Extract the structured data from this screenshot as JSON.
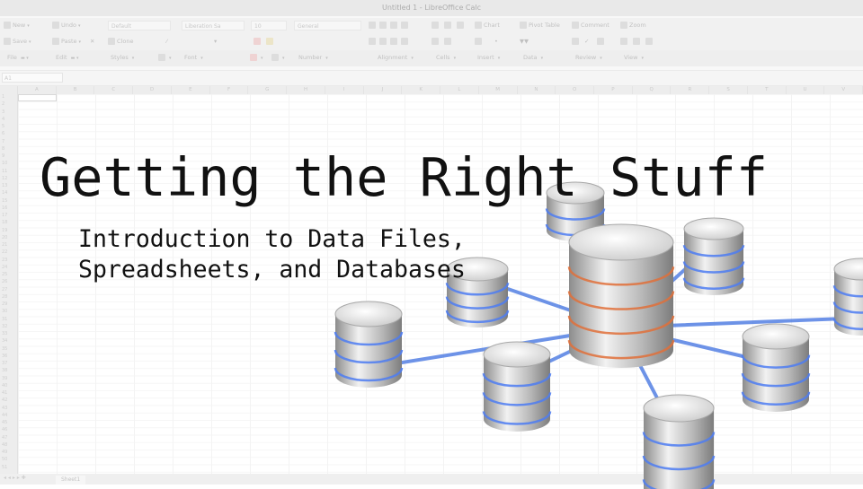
{
  "window": {
    "title": "Untitled 1 - LibreOffice Calc"
  },
  "toolbar_top": {
    "new_label": "New",
    "undo_label": "Undo",
    "style_combo": "Default",
    "font_combo": "Liberation Sa",
    "size_combo": "10",
    "format_combo": "General",
    "chart_label": "Chart",
    "pivot_label": "Pivot Table",
    "comment_label": "Comment",
    "zoom_label": "Zoom"
  },
  "toolbar_second": {
    "save_label": "Save",
    "paste_label": "Paste",
    "clone_label": "Clone"
  },
  "menu": [
    "File",
    "Edit",
    "Styles",
    "Font",
    "Number",
    "Alignment",
    "Cells",
    "Insert",
    "Data",
    "Review",
    "View"
  ],
  "formula": {
    "cell_ref": "A1"
  },
  "columns": [
    "A",
    "B",
    "C",
    "D",
    "E",
    "F",
    "G",
    "H",
    "I",
    "J",
    "K",
    "L",
    "M",
    "N",
    "O",
    "P",
    "Q",
    "R",
    "S",
    "T",
    "U",
    "V"
  ],
  "rows": [
    "1",
    "2",
    "3",
    "4",
    "5",
    "6",
    "7",
    "8",
    "9",
    "10",
    "11",
    "12",
    "13",
    "14",
    "15",
    "16",
    "17",
    "18",
    "19",
    "20",
    "21",
    "22",
    "23",
    "24",
    "25",
    "26",
    "27",
    "28",
    "29",
    "30",
    "31",
    "32",
    "33",
    "34",
    "35",
    "36",
    "37",
    "38",
    "39",
    "40",
    "41",
    "42",
    "43",
    "44",
    "45",
    "46",
    "47",
    "48",
    "49",
    "50",
    "51"
  ],
  "sheet": {
    "tab": "Sheet1"
  },
  "slide": {
    "title": "Getting the Right Stuff",
    "subtitle_line1": "Introduction to Data Files,",
    "subtitle_line2": "Spreadsheets, and Databases"
  }
}
